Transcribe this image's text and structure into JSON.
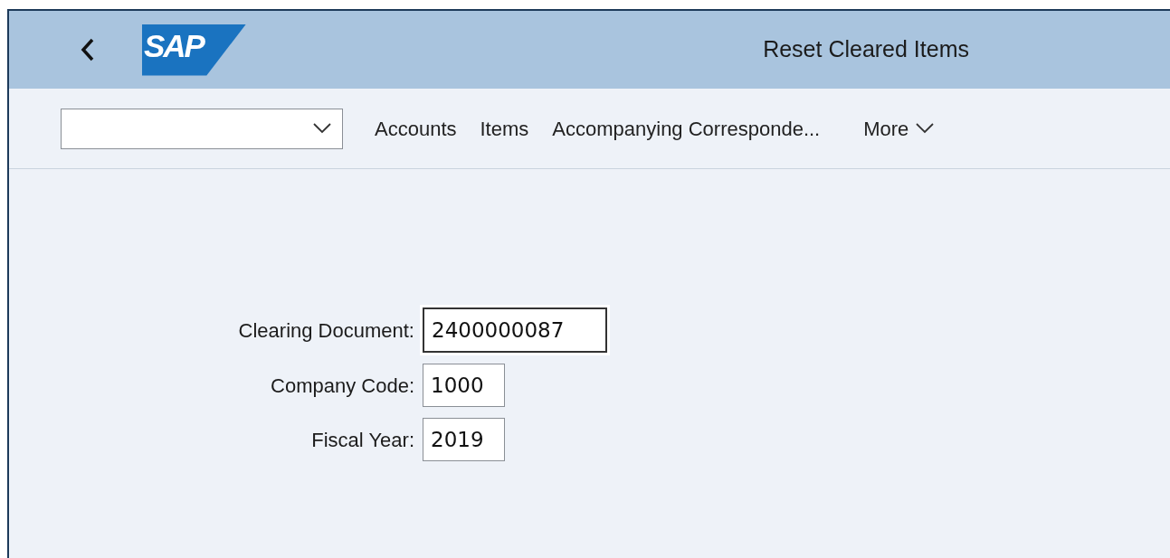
{
  "header": {
    "logo": "SAP",
    "title": "Reset Cleared Items"
  },
  "toolbar": {
    "items": [
      {
        "label": "Accounts",
        "kind": "link"
      },
      {
        "label": "Items",
        "kind": "link"
      },
      {
        "label": "Accompanying Corresponde...",
        "kind": "link"
      },
      {
        "label": "More",
        "kind": "menu"
      }
    ]
  },
  "form": {
    "fields": [
      {
        "label": "Clearing Document:",
        "value": "2400000087",
        "focused": true
      },
      {
        "label": "Company Code:",
        "value": "1000",
        "focused": false
      },
      {
        "label": "Fiscal Year:",
        "value": "2019",
        "focused": false
      }
    ]
  }
}
